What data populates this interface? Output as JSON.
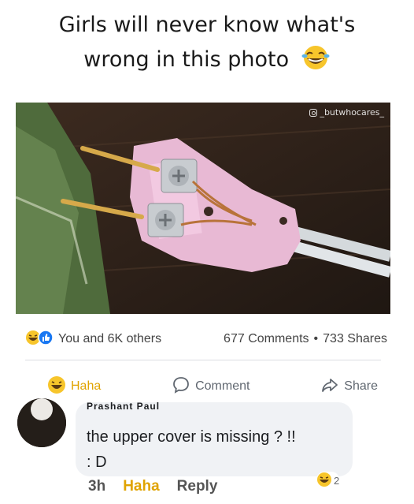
{
  "caption": {
    "line1": "Girls will never know what's",
    "line2": "wrong in this photo"
  },
  "photo": {
    "watermark": "_butwhocares_"
  },
  "post": {
    "reactions_text": "You and 6K others",
    "comments_count": "677 Comments",
    "dot": "•",
    "shares_count": "733 Shares"
  },
  "actions": {
    "haha": "Haha",
    "comment": "Comment",
    "share": "Share"
  },
  "comment": {
    "author": "Prashant Paul",
    "text_line1": "the upper cover is missing ? !!",
    "text_line2": ": D",
    "time": "3h",
    "haha": "Haha",
    "reply": "Reply",
    "reaction_count": "2"
  },
  "colors": {
    "haha": "#e0a300",
    "like_blue": "#1877f2",
    "bubble": "#f0f2f5"
  }
}
